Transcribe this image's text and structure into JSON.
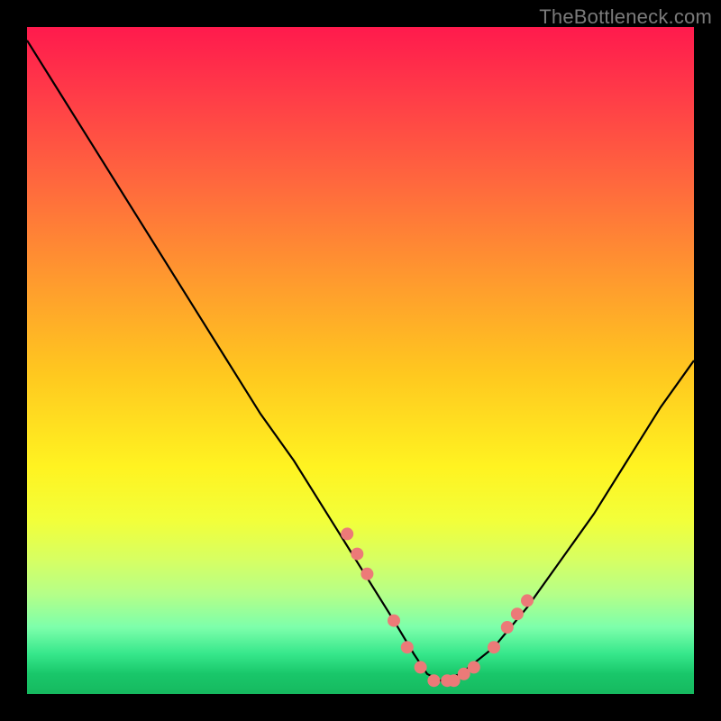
{
  "watermark": "TheBottleneck.com",
  "chart_data": {
    "type": "line",
    "title": "",
    "xlabel": "",
    "ylabel": "",
    "xlim": [
      0,
      100
    ],
    "ylim": [
      0,
      100
    ],
    "series": [
      {
        "name": "curve",
        "x": [
          0,
          5,
          10,
          15,
          20,
          25,
          30,
          35,
          40,
          45,
          50,
          55,
          58,
          60,
          62,
          65,
          70,
          75,
          80,
          85,
          90,
          95,
          100
        ],
        "values": [
          98,
          90,
          82,
          74,
          66,
          58,
          50,
          42,
          35,
          27,
          19,
          11,
          6,
          3,
          2,
          3,
          7,
          13,
          20,
          27,
          35,
          43,
          50
        ]
      }
    ],
    "markers": {
      "name": "salmon-dots",
      "color": "#ec7a78",
      "radius_px": 7,
      "x": [
        48,
        49.5,
        51,
        55,
        57,
        59,
        61,
        63,
        64,
        65.5,
        67,
        70,
        72,
        73.5,
        75
      ],
      "values": [
        24,
        21,
        18,
        11,
        7,
        4,
        2,
        2,
        2,
        3,
        4,
        7,
        10,
        12,
        14
      ]
    },
    "background": {
      "type": "vertical-gradient",
      "stops": [
        {
          "pct": 0,
          "color": "#ff1a4d"
        },
        {
          "pct": 24,
          "color": "#ff6a3d"
        },
        {
          "pct": 52,
          "color": "#ffc81f"
        },
        {
          "pct": 74,
          "color": "#f2ff3a"
        },
        {
          "pct": 90,
          "color": "#7dffab"
        },
        {
          "pct": 100,
          "color": "#16b95f"
        }
      ]
    }
  }
}
